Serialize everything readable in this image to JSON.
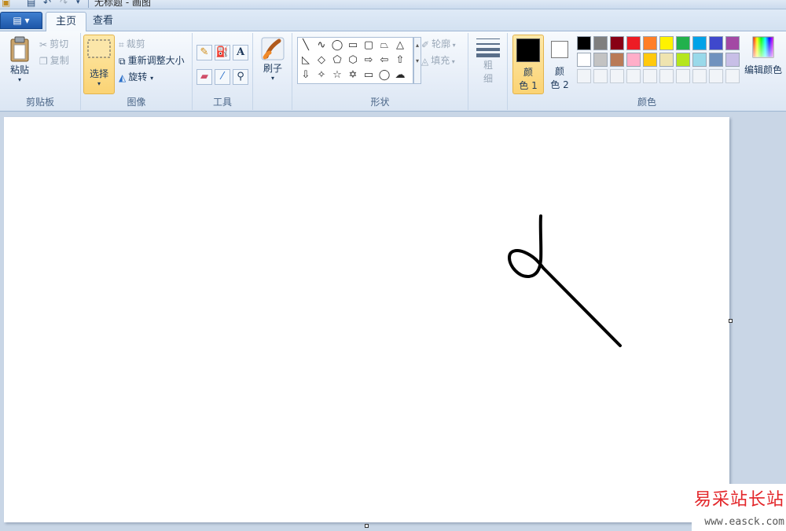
{
  "titlebar": {
    "title": "无标题 - 画图",
    "qa_save_icon": "save-icon",
    "qa_undo_icon": "undo-icon",
    "qa_redo_icon": "redo-icon"
  },
  "tabs": {
    "app_menu": "▤ ▾",
    "home": "主页",
    "view": "查看"
  },
  "clipboard": {
    "paste": "粘贴",
    "cut": "剪切",
    "copy": "复制",
    "label": "剪贴板"
  },
  "image": {
    "select": "选择",
    "crop": "裁剪",
    "resize": "重新调整大小",
    "rotate": "旋转",
    "label": "图像"
  },
  "tools": {
    "label": "工具"
  },
  "brushes": {
    "label": "刷子"
  },
  "shapes": {
    "outline": "轮廓",
    "fill": "填充",
    "label": "形状"
  },
  "size": {
    "label_1": "粗",
    "label_2": "细"
  },
  "colors": {
    "color1_a": "颜",
    "color1_b": "色 1",
    "color2_a": "颜",
    "color2_b": "色 2",
    "edit": "编辑颜色",
    "label": "颜色",
    "color1_value": "#000000",
    "color2_value": "#ffffff",
    "palette_row1": [
      "#000000",
      "#7f7f7f",
      "#880015",
      "#ed1c24",
      "#ff7f27",
      "#fff200",
      "#22b14c",
      "#00a2e8",
      "#3f48cc",
      "#a349a4"
    ],
    "palette_row2": [
      "#ffffff",
      "#c3c3c3",
      "#b97a57",
      "#ffaec9",
      "#ffc90e",
      "#efe4b0",
      "#b5e61d",
      "#99d9ea",
      "#7092be",
      "#c8bfe7"
    ]
  },
  "watermark": {
    "title": "易采站长站",
    "url": "www.easck.com"
  }
}
